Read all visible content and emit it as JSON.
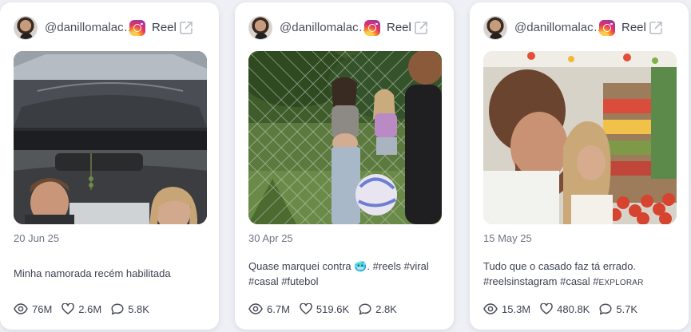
{
  "colors": {
    "background": "#eef0f5",
    "card": "#ffffff",
    "text": "#3e4252",
    "muted": "#6f7584"
  },
  "cards": [
    {
      "username": "@danillomalaca...",
      "platform_icon": "instagram-icon",
      "type": "Reel",
      "thumbnail_alt": "car interior video still",
      "date": "20 Jun 25",
      "caption_lines": [
        "Minha namorada recém habilitada"
      ],
      "views": "76M",
      "likes": "2.6M",
      "comments": "5.8K"
    },
    {
      "username": "@danillomalaca...",
      "platform_icon": "instagram-icon",
      "type": "Reel",
      "thumbnail_alt": "fence and soccer ball video still",
      "date": "30 Apr 25",
      "caption_lines": [
        "Quase marquei contra 🥶. #reels #viral",
        "#casal #futebol"
      ],
      "views": "6.7M",
      "likes": "519.6K",
      "comments": "2.8K"
    },
    {
      "username": "@danillomalaca...",
      "platform_icon": "instagram-icon",
      "type": "Reel",
      "thumbnail_alt": "supermarket video still",
      "date": "15 May 25",
      "caption_lines": [
        "Tudo que o casado faz tá errado.",
        "#reelsinstagram #casal #"
      ],
      "caption_small": "EXPLORAR",
      "views": "15.3M",
      "likes": "480.8K",
      "comments": "5.7K"
    }
  ]
}
